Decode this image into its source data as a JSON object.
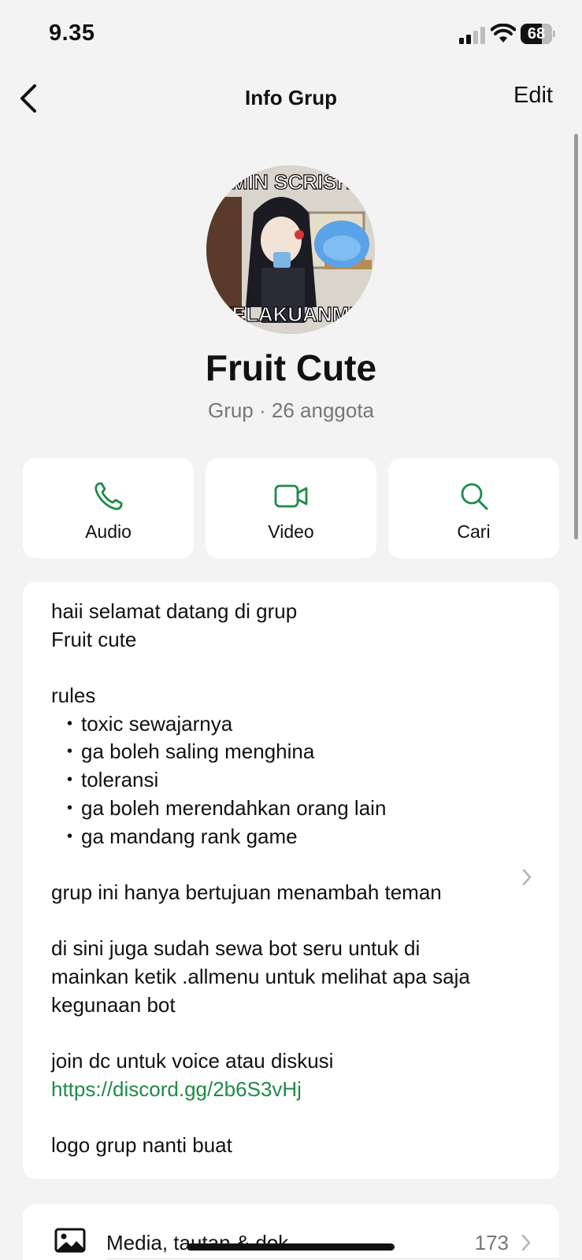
{
  "status_bar": {
    "time": "9.35",
    "battery": "68"
  },
  "nav": {
    "title": "Info Grup",
    "edit_label": "Edit"
  },
  "group": {
    "avatar_caption_top": "ADMIN SCRISHOT",
    "avatar_caption_bottom": "KELAKUANMU",
    "name": "Fruit Cute",
    "subtitle": "Grup · 26 anggota"
  },
  "actions": [
    {
      "label": "Audio",
      "icon": "phone-icon"
    },
    {
      "label": "Video",
      "icon": "video-camera-icon"
    },
    {
      "label": "Cari",
      "icon": "search-icon"
    }
  ],
  "description": {
    "line_01": "haii selamat datang di grup",
    "line_02": "Fruit cute",
    "line_03": "rules",
    "rule_1": "toxic sewajarnya",
    "rule_2": "ga boleh saling menghina",
    "rule_3": "toleransi",
    "rule_4": "ga boleh merendahkan orang lain",
    "rule_5": "ga mandang rank game",
    "line_04": "grup ini hanya bertujuan menambah teman",
    "line_05": "di sini juga sudah sewa bot seru untuk di",
    "line_06": "mainkan ketik .allmenu untuk melihat apa saja",
    "line_07": "kegunaan bot",
    "line_08": "join dc untuk voice atau diskusi",
    "link": "https://discord.gg/2b6S3vHj",
    "line_09": "logo grup nanti buat"
  },
  "media": {
    "label": "Media, tautan & dok",
    "count": "173",
    "icon": "image-icon"
  },
  "colors": {
    "accent_green": "#1f8a4a",
    "background": "#f3f3f3",
    "card": "#ffffff"
  }
}
